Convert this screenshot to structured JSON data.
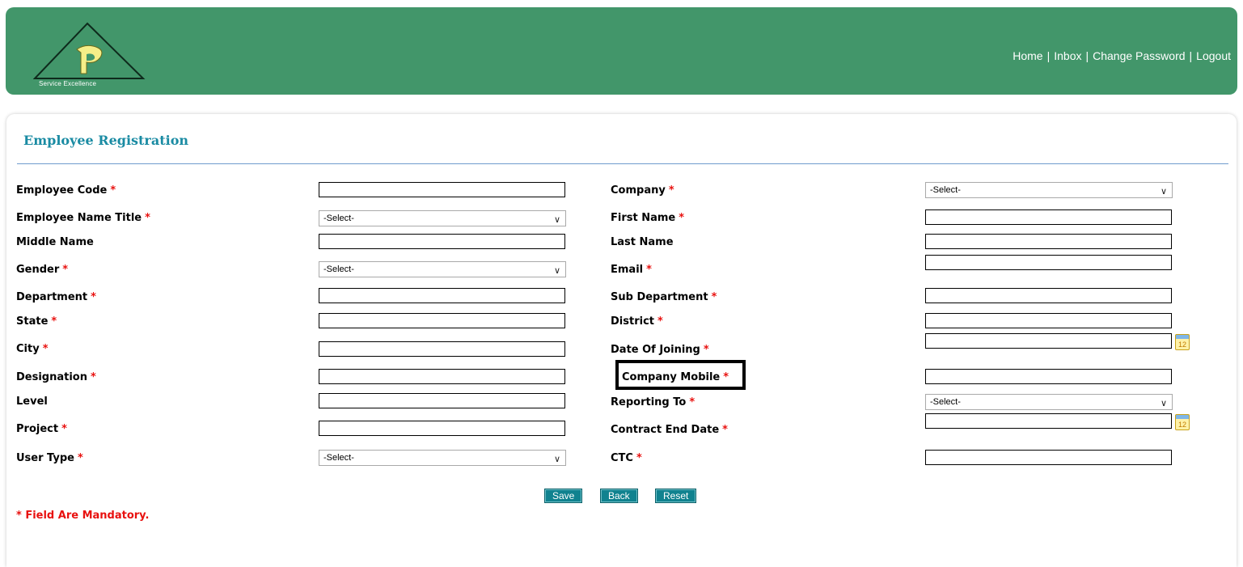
{
  "header": {
    "logo_text": "Service Excellence",
    "nav": [
      {
        "label": "Home"
      },
      {
        "label": "Inbox"
      },
      {
        "label": "Change Password"
      },
      {
        "label": "Logout"
      }
    ],
    "nav_separator": "|"
  },
  "form": {
    "title": "Employee Registration",
    "required_marker": "*",
    "fields": {
      "employee_code": {
        "label": "Employee Code",
        "value": ""
      },
      "employee_name_title": {
        "label": "Employee Name Title",
        "selected": "-Select-"
      },
      "middle_name": {
        "label": "Middle Name",
        "value": ""
      },
      "gender": {
        "label": "Gender",
        "selected": "-Select-"
      },
      "department": {
        "label": "Department",
        "value": ""
      },
      "state": {
        "label": "State",
        "value": ""
      },
      "city": {
        "label": "City",
        "value": ""
      },
      "designation": {
        "label": "Designation",
        "value": ""
      },
      "level": {
        "label": "Level",
        "value": ""
      },
      "project": {
        "label": "Project",
        "value": ""
      },
      "user_type": {
        "label": "User Type",
        "selected": "-Select-"
      },
      "company": {
        "label": "Company",
        "selected": "-Select-"
      },
      "first_name": {
        "label": "First Name",
        "value": ""
      },
      "last_name": {
        "label": "Last Name",
        "value": ""
      },
      "email": {
        "label": "Email",
        "value": ""
      },
      "sub_department": {
        "label": "Sub Department",
        "value": ""
      },
      "district": {
        "label": "District",
        "value": ""
      },
      "date_of_joining": {
        "label": "Date Of Joining",
        "value": ""
      },
      "company_mobile": {
        "label": "Company Mobile",
        "value": ""
      },
      "reporting_to": {
        "label": "Reporting To",
        "selected": "-Select-"
      },
      "contract_end_date": {
        "label": "Contract End Date",
        "value": ""
      },
      "ctc": {
        "label": "CTC",
        "value": ""
      }
    },
    "calendar_icon_text": "12",
    "buttons": {
      "save": "Save",
      "back": "Back",
      "reset": "Reset"
    },
    "mandatory_note": "* Field Are Mandatory."
  },
  "colors": {
    "header_bg": "#42966a",
    "title": "#1a8ba3",
    "required": "#e8110f",
    "button_bg": "#10828f"
  }
}
